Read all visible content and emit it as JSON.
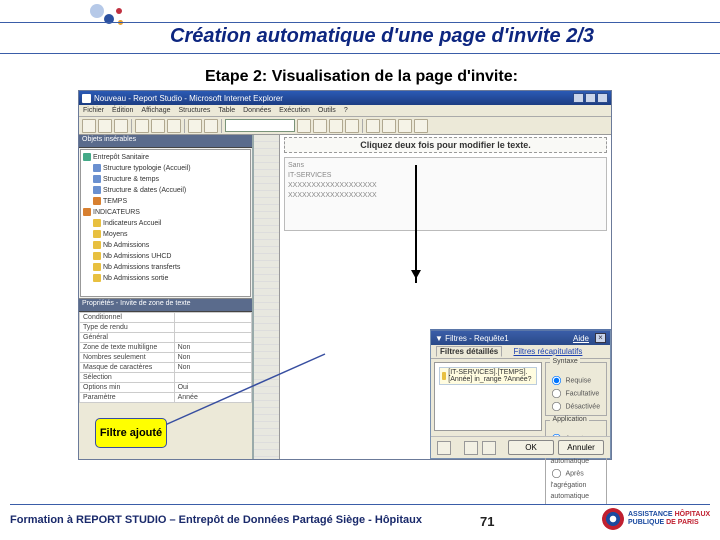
{
  "slide": {
    "title": "Création automatique d'une page d'invite 2/3",
    "subtitle": "Etape 2: Visualisation de la page d'invite:",
    "callout": "Filtre ajouté",
    "footer": "Formation à REPORT STUDIO – Entrepôt de Données Partagé Siège - Hôpitaux",
    "page": "71",
    "logo_l1": "ASSISTANCE",
    "logo_l2": "PUBLIQUE",
    "logo_l3": "HÔPITAUX",
    "logo_l4": "DE PARIS"
  },
  "window": {
    "title": "Nouveau - Report Studio - Microsoft Internet Explorer",
    "menu": [
      "Fichier",
      "Édition",
      "Affichage",
      "Structures",
      "Table",
      "Données",
      "Exécution",
      "Outils",
      "?"
    ],
    "left_panel_title": "Objets insérables",
    "tree": [
      {
        "cls": "g",
        "ind": "",
        "t": "Entrepôt Sanitaire"
      },
      {
        "cls": "b",
        "ind": "ind1",
        "t": "Structure typologie (Accueil)"
      },
      {
        "cls": "b",
        "ind": "ind1",
        "t": "Structure & temps"
      },
      {
        "cls": "b",
        "ind": "ind1",
        "t": "Structure & dates (Accueil)"
      },
      {
        "cls": "or",
        "ind": "ind1",
        "t": "TEMPS"
      },
      {
        "cls": "or",
        "ind": "",
        "t": "INDICATEURS"
      },
      {
        "cls": "y",
        "ind": "ind1",
        "t": "Indicateurs Accueil"
      },
      {
        "cls": "y",
        "ind": "ind1",
        "t": "Moyens"
      },
      {
        "cls": "y",
        "ind": "ind1",
        "t": "Nb Admissions"
      },
      {
        "cls": "y",
        "ind": "ind1",
        "t": "Nb Admissions UHCD"
      },
      {
        "cls": "y",
        "ind": "ind1",
        "t": "Nb Admissions transferts"
      },
      {
        "cls": "y",
        "ind": "ind1",
        "t": "Nb Admissions sortie"
      }
    ],
    "props_title": "Propriétés - Invite de zone de texte",
    "props": [
      {
        "k": "Conditionnel",
        "v": ""
      },
      {
        "k": "Type de rendu",
        "v": ""
      },
      {
        "k": "Général",
        "v": ""
      },
      {
        "k": "Zone de texte multiligne",
        "v": "Non"
      },
      {
        "k": "Nombres seulement",
        "v": "Non"
      },
      {
        "k": "Masque de caractères",
        "v": "Non"
      },
      {
        "k": "Sélection",
        "v": ""
      },
      {
        "k": "Options min",
        "v": "Oui"
      },
      {
        "k": "Paramètre",
        "v": "Année"
      }
    ],
    "canvas_hint": "Cliquez deux fois pour modifier le texte.",
    "canvas_rows": [
      "Sans",
      "",
      "",
      "IT-SERVICES",
      "XXXXXXXXXXXXXXXXXXX",
      "XXXXXXXXXXXXXXXXXXX"
    ]
  },
  "modal": {
    "title": "Filtres - Requête1",
    "help": "Aide",
    "tab_active": "Filtres détaillés",
    "tab_link": "Filtres récapitulatifs",
    "filter_expr": "[IT-SERVICES].[TEMPS].[Année] in_range ?Année?",
    "group1": "Syntaxe",
    "g1_opts": [
      "Requise",
      "Facultative",
      "Désactivée"
    ],
    "group2": "Application",
    "g2_opts": [
      "Avant l'agrégation automatique",
      "Après l'agrégation automatique"
    ],
    "ok": "OK",
    "cancel": "Annuler"
  }
}
